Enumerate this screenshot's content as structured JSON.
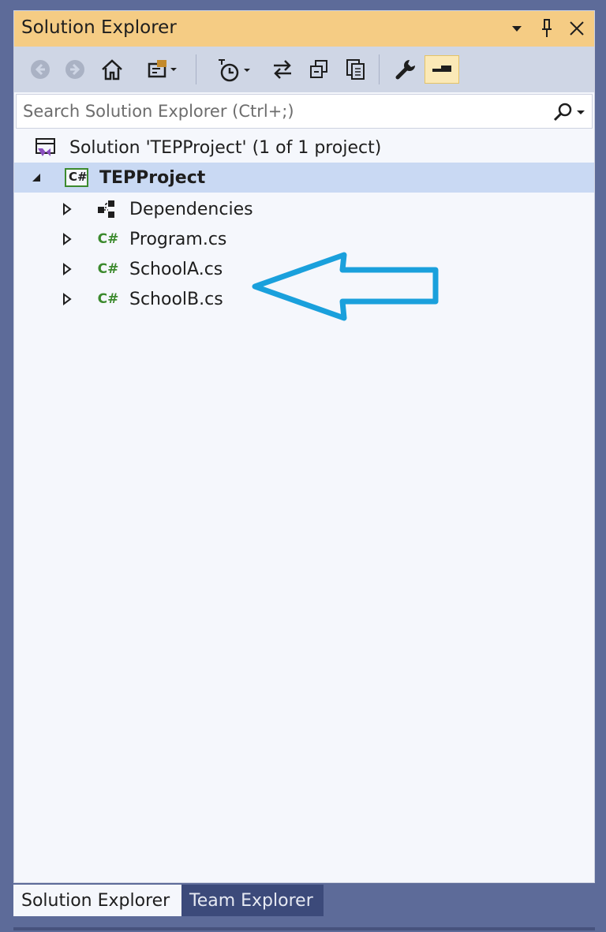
{
  "window": {
    "title": "Solution Explorer",
    "controls": [
      "dropdown-icon",
      "pin-icon",
      "close-icon"
    ]
  },
  "toolbar": {
    "buttons": [
      {
        "name": "back-button",
        "icon": "back-arrow-icon"
      },
      {
        "name": "forward-button",
        "icon": "forward-arrow-icon"
      },
      {
        "name": "home-button",
        "icon": "home-icon"
      },
      {
        "name": "switch-views-button",
        "icon": "switch-views-icon"
      },
      {
        "name": "pending-changes-filter-button",
        "icon": "clock-filter-icon"
      },
      {
        "name": "sync-button",
        "icon": "sync-icon"
      },
      {
        "name": "collapse-all-button",
        "icon": "collapse-all-icon"
      },
      {
        "name": "show-all-files-button",
        "icon": "show-all-files-icon"
      },
      {
        "name": "properties-button",
        "icon": "wrench-icon"
      },
      {
        "name": "preview-selected-button",
        "icon": "preview-icon",
        "active": true
      }
    ]
  },
  "search": {
    "placeholder": "Search Solution Explorer (Ctrl+;)",
    "value": ""
  },
  "tree": {
    "solution": "Solution 'TEPProject' (1 of 1 project)",
    "project": "TEPProject",
    "project_badge": "C#",
    "items": [
      {
        "label": "Dependencies",
        "icon": "dependencies-icon"
      },
      {
        "label": "Program.cs",
        "icon": "csharp-file-icon"
      },
      {
        "label": "SchoolA.cs",
        "icon": "csharp-file-icon"
      },
      {
        "label": "SchoolB.cs",
        "icon": "csharp-file-icon"
      }
    ],
    "file_badge": "C#"
  },
  "tabs": [
    {
      "label": "Solution Explorer",
      "active": true
    },
    {
      "label": "Team Explorer",
      "active": false
    }
  ],
  "colors": {
    "frame": "#5d6b99",
    "title_bar": "#f5cc84",
    "toolbar": "#cfd6e5",
    "selection": "#c9d9f3",
    "annotation_arrow": "#1aa0dc",
    "csharp_green": "#3c8a2e"
  }
}
